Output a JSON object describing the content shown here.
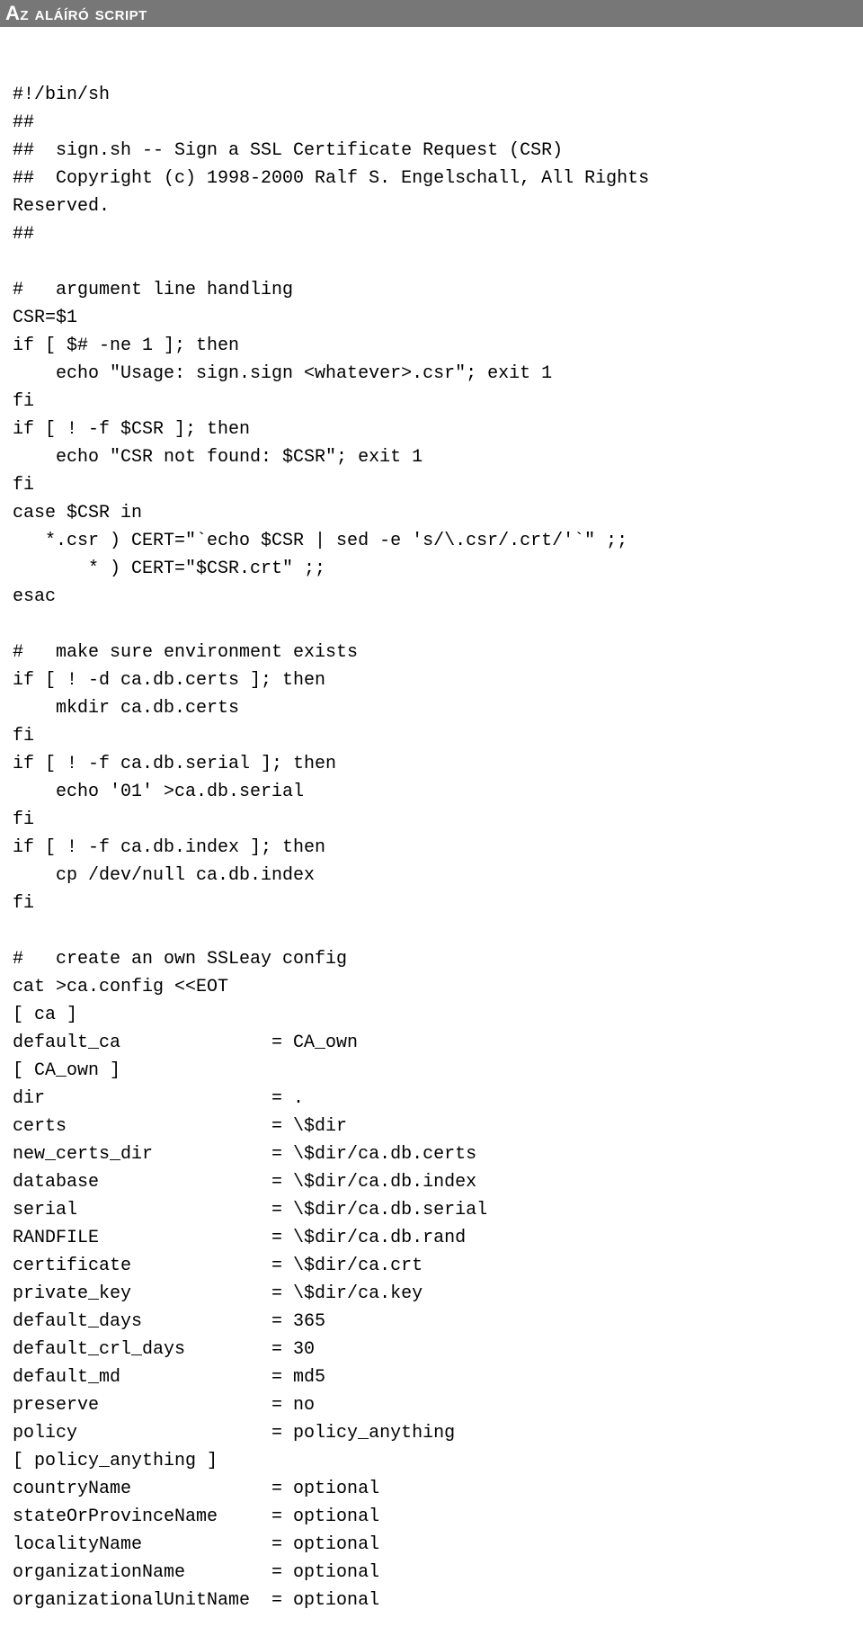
{
  "header": {
    "title": "Az aláíró script"
  },
  "code": {
    "shebang": "#!/bin/sh",
    "hh1": "##",
    "desc1": "##  sign.sh -- Sign a SSL Certificate Request (CSR)",
    "desc2": "##  Copyright (c) 1998-2000 Ralf S. Engelschall, All Rights\nReserved.",
    "hh2": "##",
    "argcomment": "#   argument line handling",
    "csr_assign": "CSR=$1",
    "if1": "if [ $# -ne 1 ]; then",
    "if1_body": "    echo \"Usage: sign.sign <whatever>.csr\"; exit 1",
    "fi1": "fi",
    "if2": "if [ ! -f $CSR ]; then",
    "if2_body": "    echo \"CSR not found: $CSR\"; exit 1",
    "fi2": "fi",
    "case1": "case $CSR in",
    "case_csr": "   *.csr ) CERT=\"`echo $CSR | sed -e 's/\\.csr/.crt/'`\" ;;",
    "case_default": "       * ) CERT=\"$CSR.crt\" ;;",
    "esac": "esac",
    "envcomment": "#   make sure environment exists",
    "if3": "if [ ! -d ca.db.certs ]; then",
    "if3_body": "    mkdir ca.db.certs",
    "fi3": "fi",
    "if4": "if [ ! -f ca.db.serial ]; then",
    "if4_body": "    echo '01' >ca.db.serial",
    "fi4": "fi",
    "if5": "if [ ! -f ca.db.index ]; then",
    "if5_body": "    cp /dev/null ca.db.index",
    "fi5": "fi",
    "createcomment": "#   create an own SSLeay config",
    "cat": "cat >ca.config <<EOT",
    "ca_section": "[ ca ]",
    "default_ca": "default_ca              = CA_own",
    "ca_own_section": "[ CA_own ]",
    "dir": "dir                     = .",
    "certs": "certs                   = \\$dir",
    "new_certs_dir": "new_certs_dir           = \\$dir/ca.db.certs",
    "database": "database                = \\$dir/ca.db.index",
    "serial": "serial                  = \\$dir/ca.db.serial",
    "RANDFILE": "RANDFILE                = \\$dir/ca.db.rand",
    "certificate": "certificate             = \\$dir/ca.crt",
    "private_key": "private_key             = \\$dir/ca.key",
    "default_days": "default_days            = 365",
    "default_crl_days": "default_crl_days        = 30",
    "default_md": "default_md              = md5",
    "preserve": "preserve                = no",
    "policy": "policy                  = policy_anything",
    "policy_section": "[ policy_anything ]",
    "countryName": "countryName             = optional",
    "stateOrProvinceName": "stateOrProvinceName     = optional",
    "localityName": "localityName            = optional",
    "organizationName": "organizationName        = optional",
    "organizationalUnitName": "organizationalUnitName  = optional"
  }
}
